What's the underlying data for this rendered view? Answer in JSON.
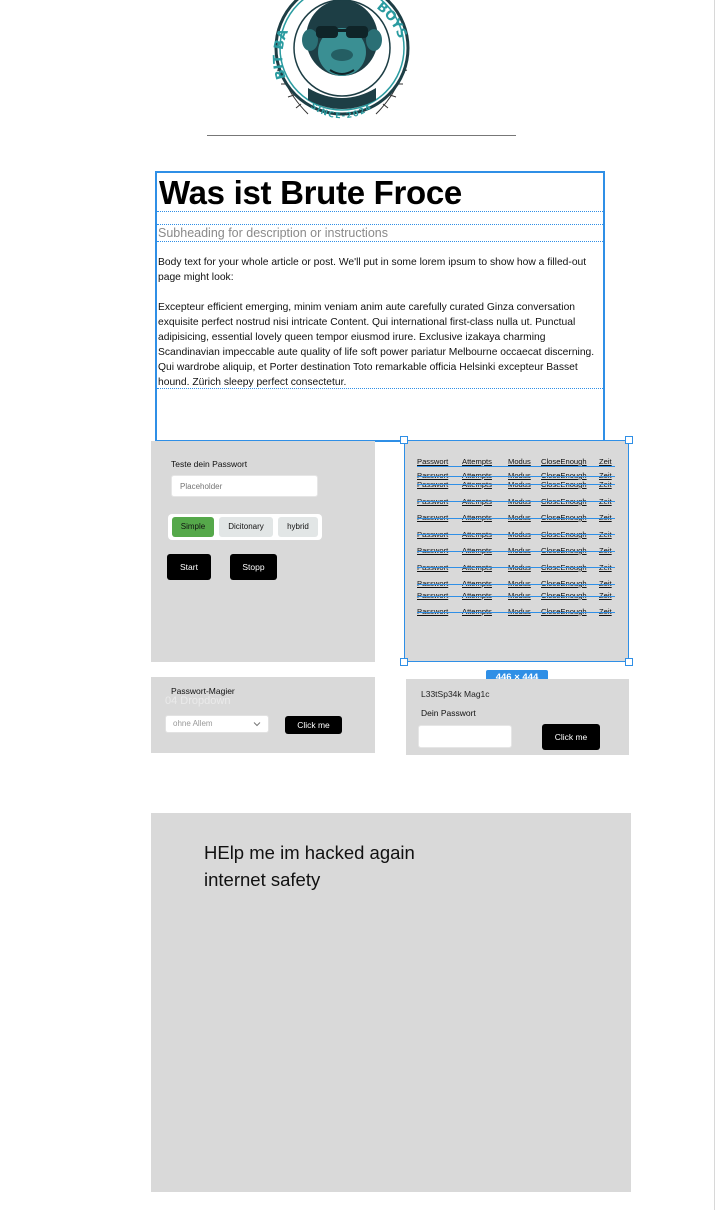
{
  "logo": {
    "text_left": "BIT BA",
    "text_right": "BOYS",
    "text_bottom": "SINCE-2024",
    "colors": {
      "ring": "#2a9ba0",
      "fur": "#1d3e45",
      "face": "#3a8f93"
    }
  },
  "article": {
    "title": "Was ist Brute Froce",
    "subheading": "Subheading for description or instructions",
    "paragraph1": "Body text for your whole article or post. We'll put in some lorem ipsum to show how a filled-out page might look:",
    "paragraph2": "Excepteur efficient emerging, minim veniam anim aute carefully curated Ginza conversation exquisite perfect nostrud nisi intricate Content. Qui  international first-class nulla ut. Punctual adipisicing, essential lovely queen tempor eiusmod irure. Exclusive izakaya charming Scandinavian impeccable aute quality of life soft power pariatur Melbourne occaecat discerning. Qui wardrobe aliquip, et Porter destination Toto remarkable officia Helsinki excepteur Basset hound. Zürich sleepy perfect consectetur."
  },
  "tester": {
    "label": "Teste dein Passwort",
    "input_placeholder": "Placeholder",
    "modes": [
      "Simple",
      "Dicitonary",
      "hybrid"
    ],
    "start_label": "Start",
    "stop_label": "Stopp",
    "active_color": "#55a84a"
  },
  "results": {
    "columns": [
      "Passwort",
      "Attempts",
      "Modus",
      "CloseEnough",
      "Zeit"
    ],
    "row_count": 11
  },
  "selection": {
    "size_label": "446 × 444",
    "color": "#2f8fe6"
  },
  "magier": {
    "title": "Passwort-Magier",
    "ghost_text": "04 Dropdown",
    "select_value": "ohne Allem",
    "button_label": "Click me"
  },
  "generated": {
    "value": "L33tSp34k Mag1c",
    "label": "Dein Passwort",
    "button_label": "Click me"
  },
  "footer_panel": {
    "line1": "HElp me im hacked again",
    "line2": "internet safety"
  }
}
